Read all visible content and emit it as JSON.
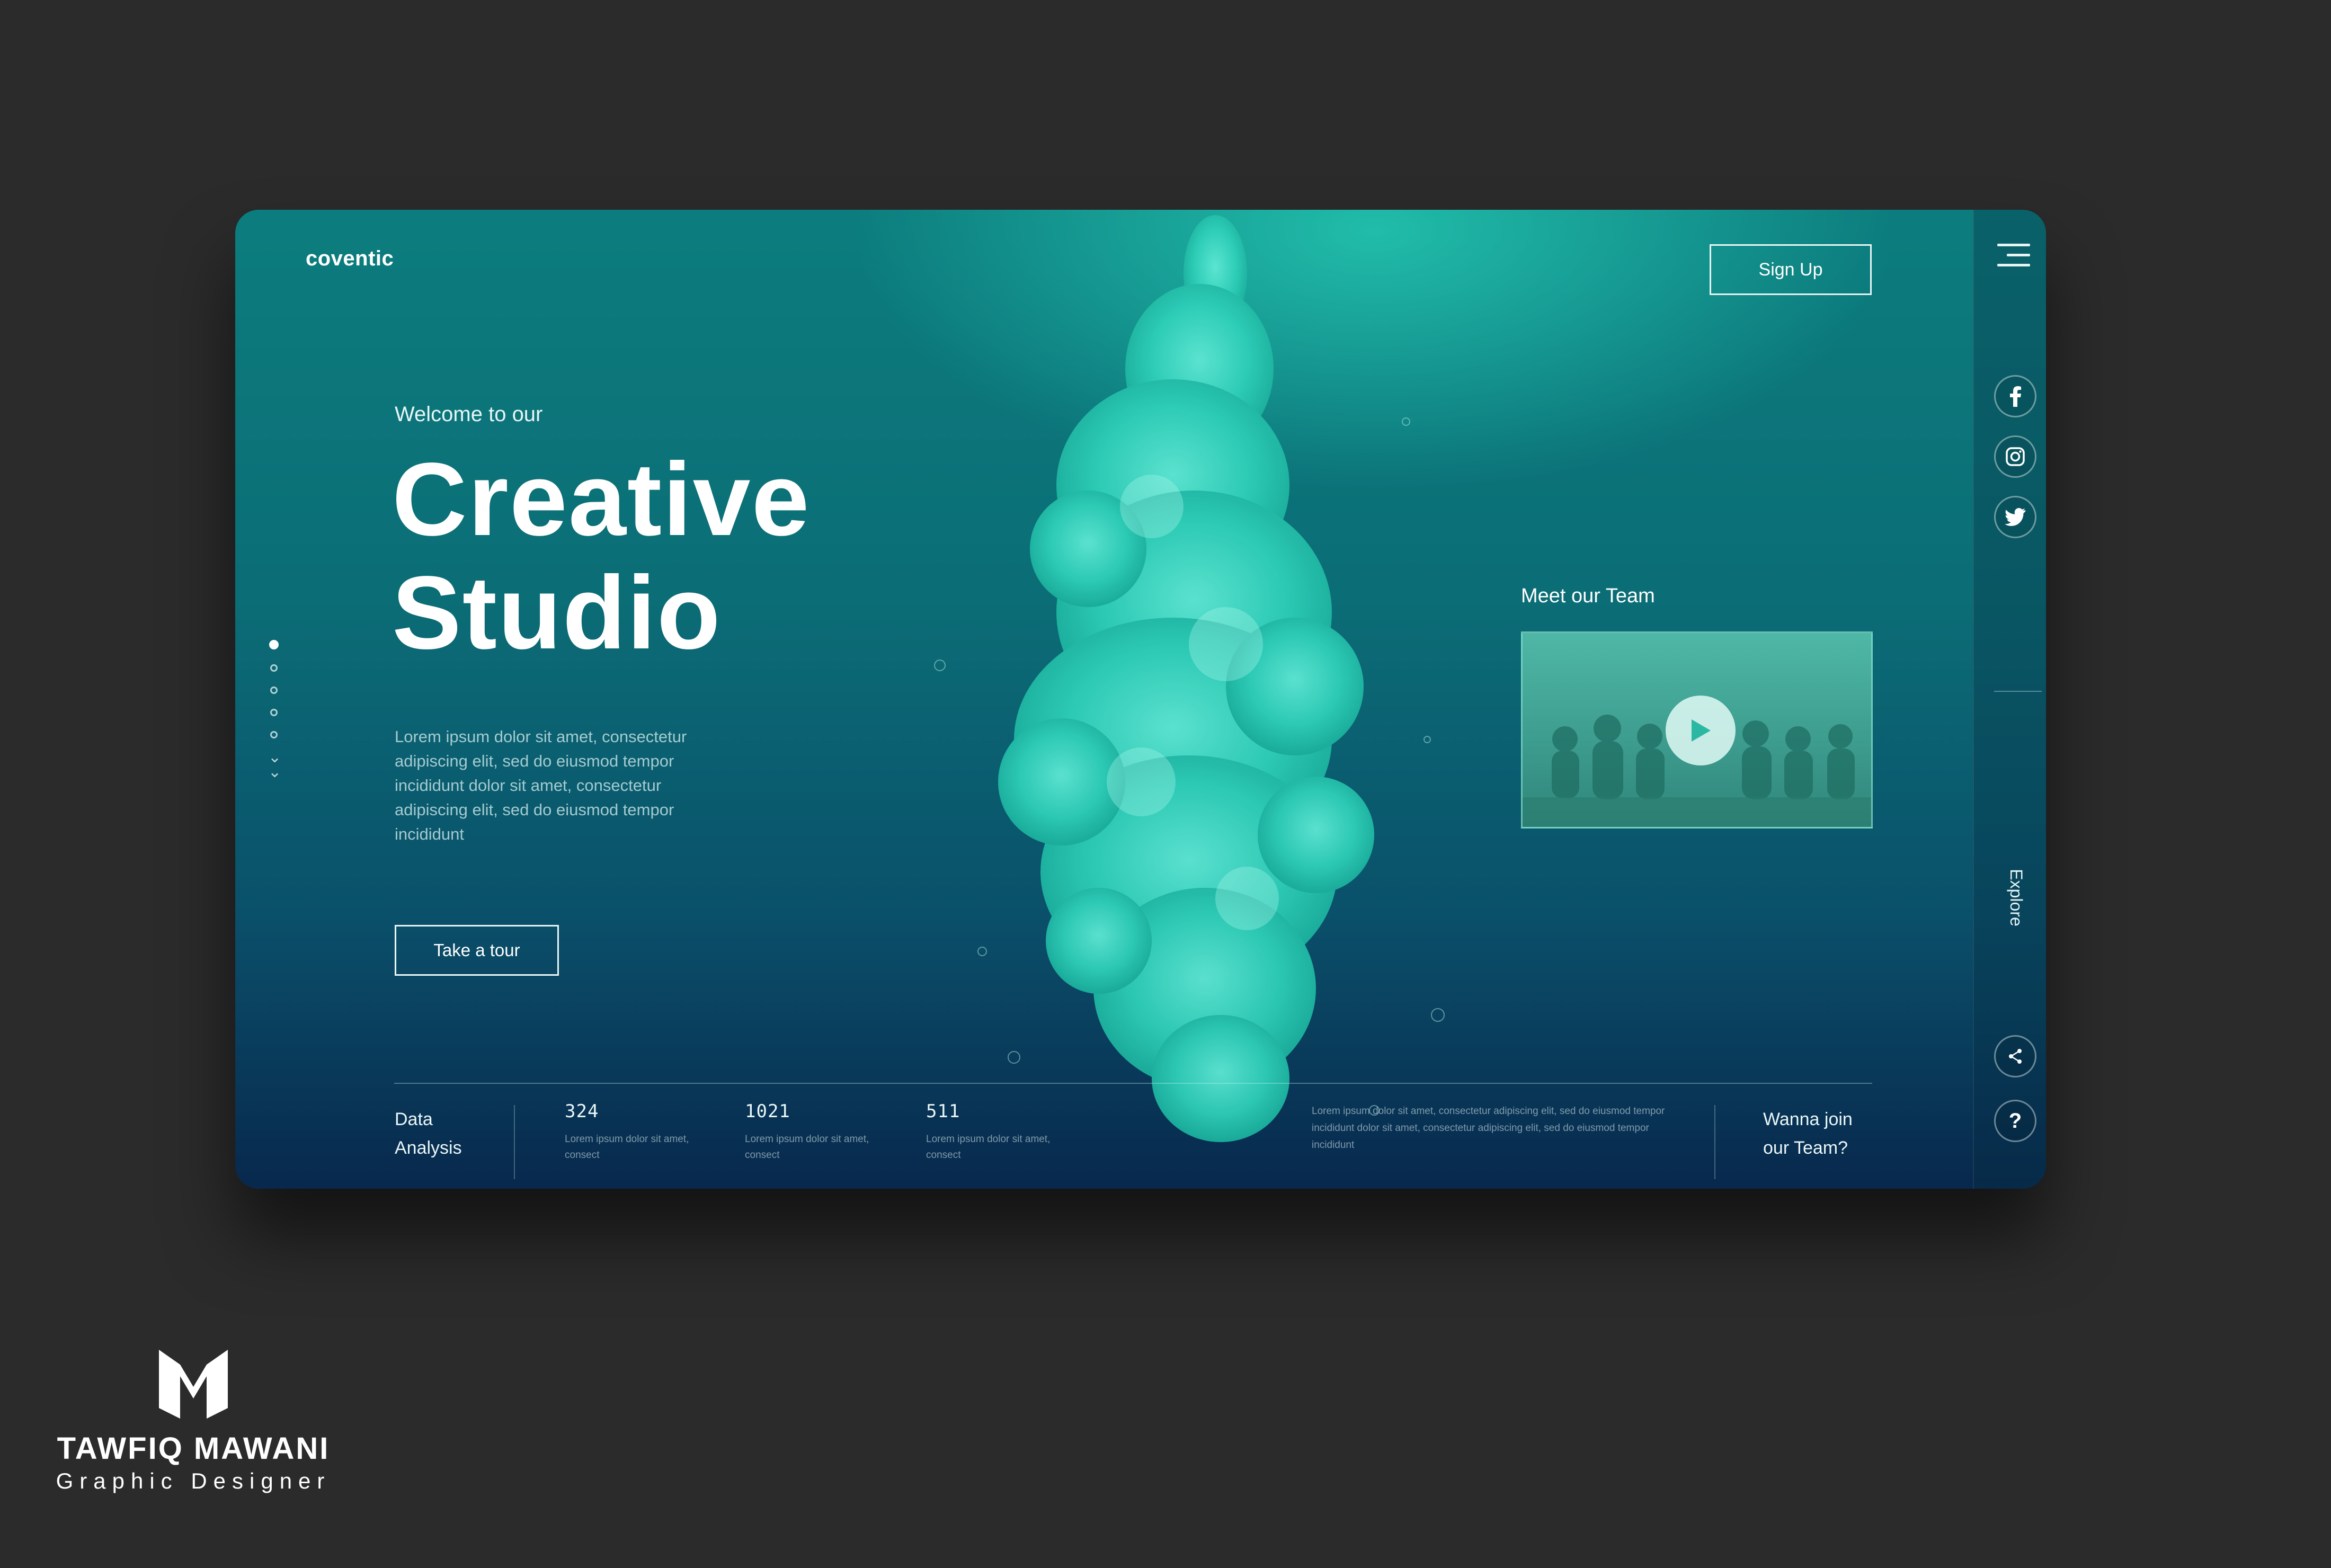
{
  "header": {
    "logo": "coventic",
    "signup_label": "Sign Up"
  },
  "hero": {
    "welcome": "Welcome to our",
    "title_line1": "Creative",
    "title_line2": "Studio",
    "description": "Lorem ipsum dolor sit amet, consectetur adipiscing elit, sed do eiusmod tempor incididunt dolor sit amet, consectetur adipiscing elit, sed do eiusmod tempor incididunt",
    "tour_label": "Take a tour"
  },
  "pager": {
    "count": 5,
    "active_index": 0
  },
  "team": {
    "label": "Meet our Team"
  },
  "sidebar": {
    "explore": "Explore",
    "social": [
      "facebook-icon",
      "instagram-icon",
      "twitter-icon"
    ]
  },
  "bottom": {
    "data_label_1": "Data",
    "data_label_2": "Analysis",
    "stats": [
      {
        "value": "324",
        "desc": "Lorem ipsum dolor sit amet, consect"
      },
      {
        "value": "1021",
        "desc": "Lorem ipsum dolor sit amet, consect"
      },
      {
        "value": "511",
        "desc": "Lorem ipsum dolor sit amet, consect"
      }
    ],
    "lorem": "Lorem ipsum dolor sit amet, consectetur adipiscing elit, sed do eiusmod tempor incididunt dolor sit amet, consectetur adipiscing elit, sed do eiusmod tempor incididunt",
    "join_line1": "Wanna join",
    "join_line2": "our Team?"
  },
  "credit": {
    "name": "TAWFIQ MAWANI",
    "role": "Graphic Designer"
  },
  "colors": {
    "background": "#2b2b2b",
    "accent": "#2fd3bd",
    "card_top": "#0c7d7e",
    "card_bottom": "#08284d"
  }
}
